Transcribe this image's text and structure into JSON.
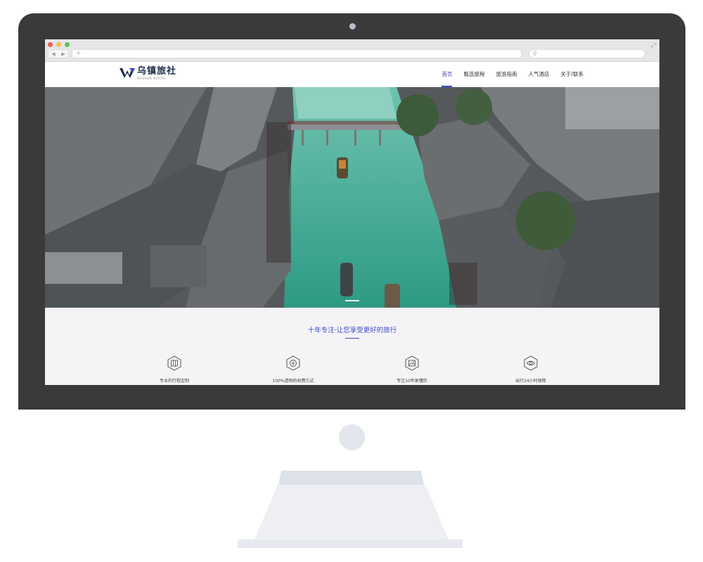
{
  "browser": {
    "url": "",
    "search_placeholder": "",
    "back_glyph": "◀",
    "forward_glyph": "▶",
    "new_tab_glyph": "+",
    "search_glyph": "⚲",
    "expand_glyph": "⤢"
  },
  "site": {
    "logo_title": "乌镇旅社",
    "logo_subtitle": "WUZHEN HOSTEL",
    "brand_color": "#3c47c9",
    "logo_color": "#1d2a4a"
  },
  "nav": {
    "items": [
      {
        "label": "首页",
        "active": true
      },
      {
        "label": "甄选旅程",
        "active": false
      },
      {
        "label": "旅游指南",
        "active": false
      },
      {
        "label": "人气酒店",
        "active": false
      },
      {
        "label": "关于/联系",
        "active": false
      }
    ]
  },
  "hero": {
    "image": "aerial view of water town canal with boats and bridge"
  },
  "features": {
    "title": "十年专注·让您享受更好的旅行",
    "items": [
      {
        "label": "专业的行程定制",
        "icon": "map-icon"
      },
      {
        "label": "100%透明的收费方式",
        "icon": "shield-icon"
      },
      {
        "label": "专注10年更懂你",
        "icon": "photo-icon"
      },
      {
        "label": "出行24小时保障",
        "icon": "eye-icon"
      }
    ]
  }
}
